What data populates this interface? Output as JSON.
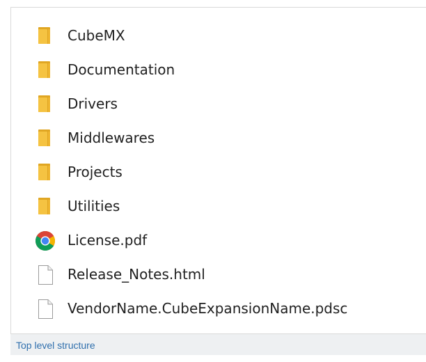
{
  "explorer": {
    "items": [
      {
        "name": "CubeMX",
        "icon": "folder-icon",
        "type": "folder"
      },
      {
        "name": "Documentation",
        "icon": "folder-icon",
        "type": "folder"
      },
      {
        "name": "Drivers",
        "icon": "folder-icon",
        "type": "folder"
      },
      {
        "name": "Middlewares",
        "icon": "folder-icon",
        "type": "folder"
      },
      {
        "name": "Projects",
        "icon": "folder-icon",
        "type": "folder"
      },
      {
        "name": "Utilities",
        "icon": "folder-icon",
        "type": "folder"
      },
      {
        "name": "License.pdf",
        "icon": "chrome-icon",
        "type": "pdf"
      },
      {
        "name": "Release_Notes.html",
        "icon": "document-icon",
        "type": "html"
      },
      {
        "name": "VendorName.CubeExpansionName.pdsc",
        "icon": "document-icon",
        "type": "pdsc"
      }
    ]
  },
  "caption": {
    "text": "Top level structure"
  },
  "colors": {
    "folder": "#f5c342",
    "folder_dark": "#e0a623",
    "caption_text": "#2f6fad",
    "caption_bg": "#eef0f2"
  }
}
